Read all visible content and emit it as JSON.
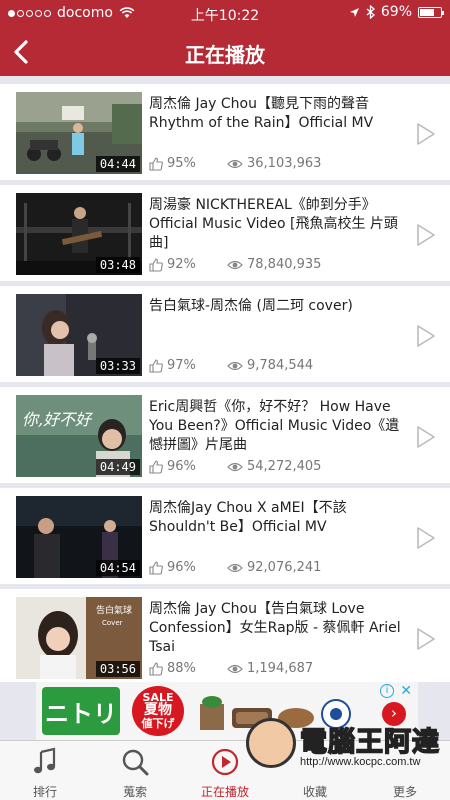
{
  "status_bar": {
    "carrier": "docomo",
    "time": "上午10:22",
    "battery": "69%",
    "battery_level": 0.69
  },
  "nav": {
    "title": "正在播放",
    "back_icon": "chevron-left-icon"
  },
  "videos": [
    {
      "title": "周杰倫 Jay Chou【聽見下雨的聲音 Rhythm of the Rain】Official MV",
      "duration": "04:44",
      "likes": "95%",
      "views": "36,103,963"
    },
    {
      "title": "周湯豪 NICKTHEREAL《帥到分手》Official Music Video [飛魚高校生 片頭曲]",
      "duration": "03:48",
      "likes": "92%",
      "views": "78,840,935"
    },
    {
      "title": "告白氣球-周杰倫 (周二珂 cover)",
      "duration": "03:33",
      "likes": "97%",
      "views": "9,784,544"
    },
    {
      "title": "Eric周興哲《你，好不好？ How Have You Been?》Official Music Video《遺憾拼圖》片尾曲",
      "duration": "04:49",
      "likes": "96%",
      "views": "54,272,405"
    },
    {
      "title": "周杰倫Jay Chou X aMEI【不該 Shouldn't Be】Official MV",
      "duration": "04:54",
      "likes": "96%",
      "views": "92,076,241"
    },
    {
      "title": "周杰倫 Jay Chou【告白氣球 Love Confession】女生Rap版 - 蔡佩軒 Ariel Tsai",
      "duration": "03:56",
      "likes": "88%",
      "views": "1,194,687"
    }
  ],
  "ad": {
    "brand": "ニトリ",
    "sale_line1": "SALE",
    "sale_line2": "夏物",
    "sale_line3": "値下げ",
    "arrow": "›",
    "info": "i",
    "close": "✕"
  },
  "watermark": {
    "text": "電腦王阿達",
    "url": "http://www.kocpc.com.tw"
  },
  "tabs": [
    {
      "label": "排行",
      "icon": "music-note-icon"
    },
    {
      "label": "蒐索",
      "icon": "search-icon"
    },
    {
      "label": "正在播放",
      "icon": "play-circle-icon",
      "active": true
    },
    {
      "label": "收藏",
      "icon": "heart-icon"
    },
    {
      "label": "更多",
      "icon": "more-icon"
    }
  ],
  "colors": {
    "brand_red": "#b52a35",
    "active_tab": "#c1272d",
    "background": "#e6e6ee"
  }
}
